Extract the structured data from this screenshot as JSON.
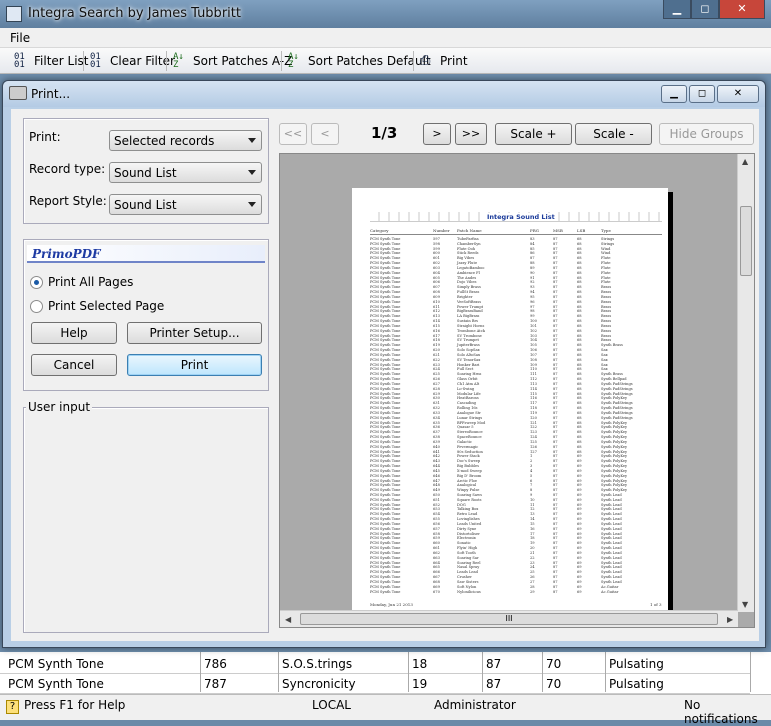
{
  "main_window": {
    "title": "Integra Search by James Tubbritt",
    "minimize": "▁",
    "maximize": "◻",
    "close": "✕"
  },
  "menu": {
    "file": "File"
  },
  "toolbar": {
    "filter_list": "Filter List",
    "clear_filter": "Clear Filter",
    "sort_az": "Sort Patches A-Z",
    "sort_default": "Sort Patches Default",
    "print": "Print"
  },
  "dialog": {
    "title": "Print...",
    "print_label": "Print:",
    "print_value": "Selected records",
    "record_type_label": "Record type:",
    "record_type_value": "Sound List",
    "report_style_label": "Report Style:",
    "report_style_value": "Sound List",
    "printer_name": "PrimoPDF",
    "radio_all": "Print All Pages",
    "radio_selected": "Print Selected Page",
    "help": "Help",
    "printer_setup": "Printer Setup...",
    "cancel": "Cancel",
    "print_button": "Print",
    "user_input": "User input",
    "nav_first": "<<",
    "nav_prev": "<",
    "page_indicator": "1/3",
    "nav_next": ">",
    "nav_last": ">>",
    "scale_plus": "Scale +",
    "scale_minus": "Scale -",
    "hide_groups": "Hide Groups",
    "hscroll_thumb": "III"
  },
  "report": {
    "title": "Integra Sound List",
    "headers": [
      "Category",
      "Number",
      "Patch Name",
      "PRG",
      "MSB",
      "LSB",
      "Type"
    ],
    "footer_date": "Monday, Jun 21 2013",
    "footer_page": "1 of 3",
    "rows": [
      [
        "PCM Synth Tone",
        "597",
        "TubeFarfisa",
        "83",
        "87",
        "68",
        "Strings"
      ],
      [
        "PCM Synth Tone",
        "598",
        "ChamberSyn",
        "84",
        "87",
        "68",
        "Strings"
      ],
      [
        "PCM Synth Tone",
        "599",
        "Flute Ooh",
        "85",
        "87",
        "68",
        "Wind"
      ],
      [
        "PCM Synth Tone",
        "600",
        "Stick Reeds",
        "86",
        "87",
        "68",
        "Wind"
      ],
      [
        "PCM Synth Tone",
        "601",
        "Big Vibes",
        "87",
        "87",
        "68",
        "Flute"
      ],
      [
        "PCM Synth Tone",
        "602",
        "Jazzy Flute",
        "88",
        "87",
        "68",
        "Flute"
      ],
      [
        "PCM Synth Tone",
        "603",
        "LegatoBamboo",
        "89",
        "87",
        "68",
        "Flute"
      ],
      [
        "PCM Synth Tone",
        "604",
        "Ambience Fl",
        "90",
        "87",
        "68",
        "Flute"
      ],
      [
        "PCM Synth Tone",
        "605",
        "The Andes",
        "91",
        "87",
        "68",
        "Flute"
      ],
      [
        "PCM Synth Tone",
        "606",
        "Dojo Vibes",
        "92",
        "87",
        "68",
        "Flute"
      ],
      [
        "PCM Synth Tone",
        "607",
        "Simply Brass",
        "93",
        "87",
        "68",
        "Brass"
      ],
      [
        "PCM Synth Tone",
        "608",
        "FullSt Brass",
        "94",
        "87",
        "68",
        "Brass"
      ],
      [
        "PCM Synth Tone",
        "609",
        "Brighter",
        "95",
        "87",
        "68",
        "Brass"
      ],
      [
        "PCM Synth Tone",
        "610",
        "VeeSoftBrass",
        "96",
        "87",
        "68",
        "Brass"
      ],
      [
        "PCM Synth Tone",
        "611",
        "Power Trumpt",
        "97",
        "87",
        "68",
        "Brass"
      ],
      [
        "PCM Synth Tone",
        "612",
        "BigBrassBand",
        "98",
        "87",
        "68",
        "Brass"
      ],
      [
        "PCM Synth Tone",
        "613",
        "LA BigBrass",
        "99",
        "87",
        "68",
        "Brass"
      ],
      [
        "PCM Synth Tone",
        "614",
        "Sustain Brs",
        "100",
        "87",
        "68",
        "Brass"
      ],
      [
        "PCM Synth Tone",
        "615",
        "Straight Horns",
        "101",
        "87",
        "68",
        "Brass"
      ],
      [
        "PCM Synth Tone",
        "616",
        "Trombone Atck",
        "102",
        "87",
        "68",
        "Brass"
      ],
      [
        "PCM Synth Tone",
        "617",
        "SV Trombone",
        "103",
        "87",
        "68",
        "Brass"
      ],
      [
        "PCM Synth Tone",
        "618",
        "SV Trumpet",
        "104",
        "87",
        "68",
        "Brass"
      ],
      [
        "PCM Synth Tone",
        "619",
        "JupiterBrass",
        "105",
        "87",
        "68",
        "Synth Brass"
      ],
      [
        "PCM Synth Tone",
        "620",
        "Solo SopSax",
        "106",
        "87",
        "68",
        "Sax"
      ],
      [
        "PCM Synth Tone",
        "621",
        "Solo AltoSax",
        "107",
        "87",
        "68",
        "Sax"
      ],
      [
        "PCM Synth Tone",
        "622",
        "SV TenorSax",
        "108",
        "87",
        "68",
        "Sax"
      ],
      [
        "PCM Synth Tone",
        "623",
        "Honker Bari",
        "109",
        "87",
        "68",
        "Sax"
      ],
      [
        "PCM Synth Tone",
        "624",
        "Full Sect",
        "110",
        "87",
        "68",
        "Sax"
      ],
      [
        "PCM Synth Tone",
        "625",
        "Soaring Hrns",
        "111",
        "87",
        "68",
        "Synth Brass"
      ],
      [
        "PCM Synth Tone",
        "626",
        "Glass Orbit",
        "112",
        "87",
        "68",
        "Synth Bellpad"
      ],
      [
        "PCM Synth Tone",
        "627",
        "Ch1 Atm Alt",
        "113",
        "87",
        "68",
        "Synth PadStrings"
      ],
      [
        "PCM Synth Tone",
        "628",
        "Lo-Swing",
        "114",
        "87",
        "68",
        "Synth PadStrings"
      ],
      [
        "PCM Synth Tone",
        "629",
        "Modular Life",
        "115",
        "87",
        "68",
        "Synth PadStrings"
      ],
      [
        "PCM Synth Tone",
        "630",
        "HeatBarons",
        "116",
        "87",
        "68",
        "Synth PolyKey"
      ],
      [
        "PCM Synth Tone",
        "631",
        "Cascading",
        "117",
        "87",
        "68",
        "Synth PadStrings"
      ],
      [
        "PCM Synth Tone",
        "632",
        "Rolling 16s",
        "118",
        "87",
        "68",
        "Synth PadStrings"
      ],
      [
        "PCM Synth Tone",
        "633",
        "Analogue Str",
        "119",
        "87",
        "68",
        "Synth PadStrings"
      ],
      [
        "PCM Synth Tone",
        "634",
        "Lunar Strings",
        "120",
        "87",
        "68",
        "Synth PadStrings"
      ],
      [
        "PCM Synth Tone",
        "635",
        "BPFsweep Mod",
        "121",
        "87",
        "68",
        "Synth PolyKey"
      ],
      [
        "PCM Synth Tone",
        "636",
        "Quasar 5",
        "122",
        "87",
        "68",
        "Synth PolyKey"
      ],
      [
        "PCM Synth Tone",
        "637",
        "StereoBounce",
        "123",
        "87",
        "68",
        "Synth PolyKey"
      ],
      [
        "PCM Synth Tone",
        "638",
        "SpaceBounce",
        "124",
        "87",
        "68",
        "Synth PolyKey"
      ],
      [
        "PCM Synth Tone",
        "639",
        "Galactic",
        "125",
        "87",
        "68",
        "Synth PolyKey"
      ],
      [
        "PCM Synth Tone",
        "640",
        "Fevermagic",
        "126",
        "87",
        "68",
        "Synth PolyKey"
      ],
      [
        "PCM Synth Tone",
        "641",
        "80s Seduction",
        "127",
        "87",
        "68",
        "Synth PolyKey"
      ],
      [
        "PCM Synth Tone",
        "642",
        "Power Stack",
        "1",
        "87",
        "69",
        "Synth PolyKey"
      ],
      [
        "PCM Synth Tone",
        "643",
        "Doc's Sweep",
        "2",
        "87",
        "69",
        "Synth PolyKey"
      ],
      [
        "PCM Synth Tone",
        "644",
        "Big Bubbles",
        "3",
        "87",
        "69",
        "Synth PolyKey"
      ],
      [
        "PCM Synth Tone",
        "645",
        "X-mod Sweep",
        "4",
        "87",
        "69",
        "Synth PolyKey"
      ],
      [
        "PCM Synth Tone",
        "646",
        "Big D' Broom",
        "5",
        "87",
        "69",
        "Synth PolyKey"
      ],
      [
        "PCM Synth Tone",
        "647",
        "Arctic Floe",
        "6",
        "87",
        "69",
        "Synth PolyKey"
      ],
      [
        "PCM Synth Tone",
        "648",
        "Analogical",
        "7",
        "87",
        "69",
        "Synth PolyKey"
      ],
      [
        "PCM Synth Tone",
        "649",
        "Winpy Pulse",
        "8",
        "87",
        "69",
        "Synth PolyKey"
      ],
      [
        "PCM Synth Tone",
        "650",
        "Soaring Saws",
        "9",
        "87",
        "69",
        "Synth Lead"
      ],
      [
        "PCM Synth Tone",
        "651",
        "Square Roots",
        "10",
        "87",
        "69",
        "Synth Lead"
      ],
      [
        "PCM Synth Tone",
        "652",
        "DOG",
        "11",
        "87",
        "69",
        "Synth Lead"
      ],
      [
        "PCM Synth Tone",
        "653",
        "Talking Box",
        "12",
        "87",
        "69",
        "Synth Lead"
      ],
      [
        "PCM Synth Tone",
        "654",
        "Retro Lead",
        "13",
        "87",
        "69",
        "Synth Lead"
      ],
      [
        "PCM Synth Tone",
        "655",
        "Lovinglishes",
        "14",
        "87",
        "69",
        "Synth Lead"
      ],
      [
        "PCM Synth Tone",
        "656",
        "Leads United",
        "15",
        "87",
        "69",
        "Synth Lead"
      ],
      [
        "PCM Synth Tone",
        "657",
        "Dirty Syne",
        "16",
        "87",
        "69",
        "Synth Lead"
      ],
      [
        "PCM Synth Tone",
        "658",
        "Distortoliser",
        "17",
        "87",
        "69",
        "Synth Lead"
      ],
      [
        "PCM Synth Tone",
        "659",
        "Electronix",
        "18",
        "87",
        "69",
        "Synth Lead"
      ],
      [
        "PCM Synth Tone",
        "660",
        "Sonatic",
        "19",
        "87",
        "69",
        "Synth Lead"
      ],
      [
        "PCM Synth Tone",
        "661",
        "Flyin' High",
        "20",
        "87",
        "69",
        "Synth Lead"
      ],
      [
        "PCM Synth Tone",
        "662",
        "Soft Tooth",
        "21",
        "87",
        "69",
        "Synth Lead"
      ],
      [
        "PCM Synth Tone",
        "663",
        "Soaring Sar",
        "22",
        "87",
        "69",
        "Synth Lead"
      ],
      [
        "PCM Synth Tone",
        "664",
        "Soaring Reel",
        "23",
        "87",
        "69",
        "Synth Lead"
      ],
      [
        "PCM Synth Tone",
        "665",
        "Nasal Spray",
        "24",
        "87",
        "69",
        "Synth Lead"
      ],
      [
        "PCM Synth Tone",
        "666",
        "Leads Lead",
        "25",
        "87",
        "69",
        "Synth Lead"
      ],
      [
        "PCM Synth Tone",
        "667",
        "Crusher",
        "26",
        "87",
        "69",
        "Synth Lead"
      ],
      [
        "PCM Synth Tone",
        "668",
        "Saw Sisters",
        "27",
        "87",
        "69",
        "Synth Lead"
      ],
      [
        "PCM Synth Tone",
        "669",
        "Soft Nylon",
        "28",
        "87",
        "69",
        "Ac.Guitar"
      ],
      [
        "PCM Synth Tone",
        "670",
        "Nylonilicious",
        "29",
        "87",
        "69",
        "Ac.Guitar"
      ]
    ]
  },
  "grid_rows": [
    {
      "category": "PCM Synth Tone",
      "number": "786",
      "name": "S.O.S.trings",
      "prg": "18",
      "msb": "87",
      "lsb": "70",
      "type": "Pulsating"
    },
    {
      "category": "PCM Synth Tone",
      "number": "787",
      "name": "Syncronicity",
      "prg": "19",
      "msb": "87",
      "lsb": "70",
      "type": "Pulsating"
    }
  ],
  "statusbar": {
    "help": "Press F1 for Help",
    "location": "LOCAL",
    "user": "Administrator",
    "notifications": "No notifications"
  }
}
